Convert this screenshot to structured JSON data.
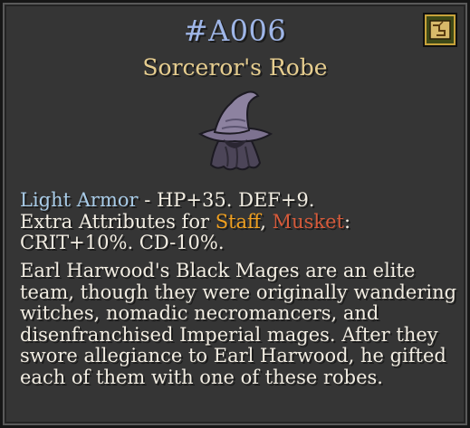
{
  "item": {
    "id": "#A006",
    "name": "Sorceror's Robe",
    "icon": "wizard-hat-robe-icon"
  },
  "stats": {
    "armor_type": "Light Armor",
    "armor_stats": " - HP+35. DEF+9.",
    "extra_prefix": "Extra Attributes for ",
    "weapon_1": "Staff",
    "separator": ", ",
    "weapon_2": "Musket",
    "colon": ":",
    "extra_stats": "CRIT+10%. CD-10%."
  },
  "description": "Earl Harwood's Black Mages are an elite team, though they were originally wandering witches, nomadic necromancers, and disenfranchised Imperial mages. After they swore allegiance to Earl Harwood, he gifted each of them with one of these robes.",
  "colors": {
    "id": "#9fb6e8",
    "name": "#e6cd8f",
    "armor_type": "#a9cce8",
    "staff": "#f0a020",
    "musket": "#d65a3a",
    "body_text": "#f2ede2",
    "panel_bg": "#353535"
  },
  "buttons": {
    "map_icon": "map-scroll-icon"
  }
}
